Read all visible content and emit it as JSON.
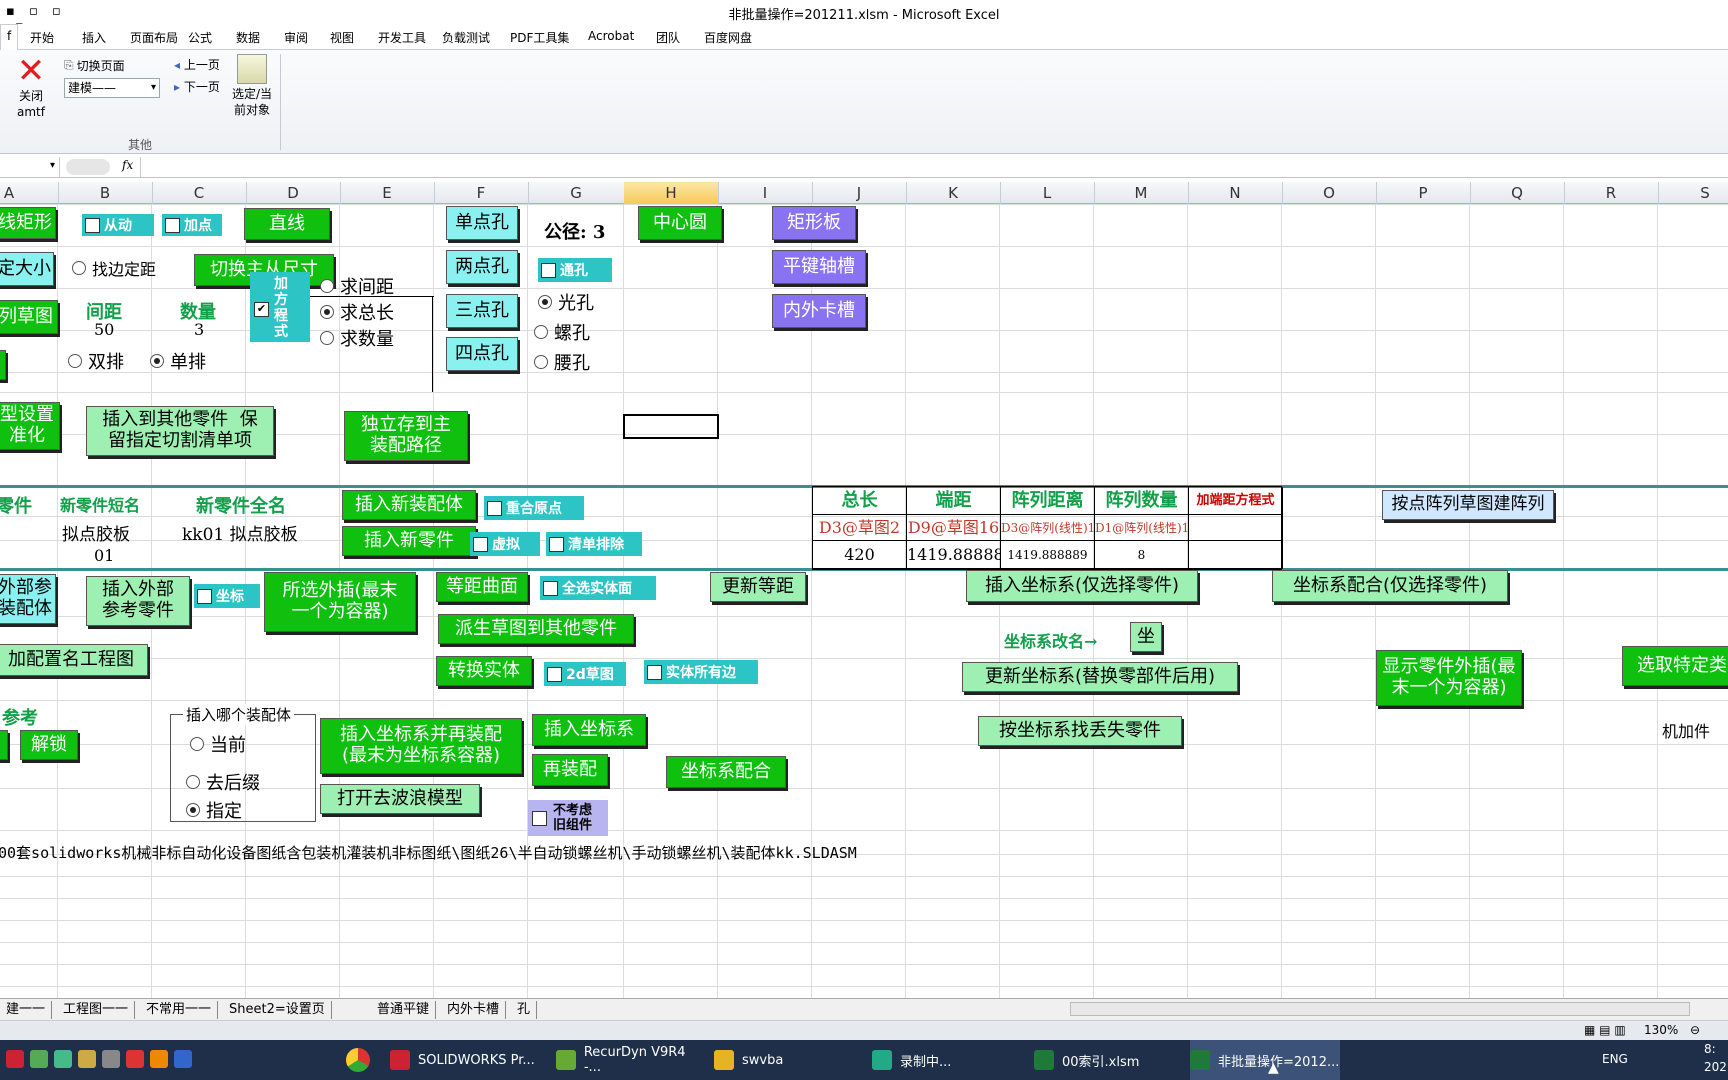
{
  "window": {
    "title": "非批量操作=201211.xlsm  -  Microsoft Excel"
  },
  "ribbon_tabs": [
    "f",
    "开始",
    "插入",
    "页面布局",
    "公式",
    "数据",
    "审阅",
    "视图",
    "开发工具",
    "负载测试",
    "PDF工具集",
    "Acrobat",
    "团队",
    "百度网盘"
  ],
  "ribbon": {
    "close_label": "关闭\namtf",
    "switch_page": "切换页面",
    "combo_value": "建模——",
    "prev_page": "上一页",
    "next_page": "下一页",
    "select_label": "选定/当\n前对象",
    "group_label": "其他"
  },
  "formula_bar": {
    "fx": "fx",
    "value": ""
  },
  "columns": [
    "A",
    "B",
    "C",
    "D",
    "E",
    "F",
    "G",
    "H",
    "I",
    "J",
    "K",
    "L",
    "M",
    "N",
    "O",
    "P",
    "Q",
    "R",
    "S"
  ],
  "selected_column": "H",
  "buttons": {
    "line_rect": "线矩形",
    "fixed_size": "定大小",
    "array_sketch": "列草图",
    "type_setting": "型设置\n准化",
    "line": "直线",
    "switch_main": "切换主从尺寸",
    "insert_other": "插入到其他零件  保\n留指定切割清单项",
    "standalone_save": "独立存到主\n装配路径",
    "single_hole": "单点孔",
    "two_hole": "两点孔",
    "three_hole": "三点孔",
    "four_hole": "四点孔",
    "center_circle": "中心圆",
    "rect_plate": "矩形板",
    "key_slot": "平键轴槽",
    "snap_groove": "内外卡槽",
    "insert_new_asm": "插入新装配体",
    "insert_new_part": "插入新零件",
    "array_by_point": "按点阵列草图建阵列",
    "ext_ref_asm": "外部参\n装配体",
    "insert_ext_ref_part": "插入外部\n参考零件",
    "selected_ext": "所选外插(最末\n一个为容器)",
    "offset_surface": "等距曲面",
    "update_offset": "更新等距",
    "derived_sketch": "派生草图到其他零件",
    "convert_entity": "转换实体",
    "insert_cs_only": "插入坐标系(仅选择零件)",
    "cs_mate_only": "坐标系配合(仅选择零件)",
    "rename_cs_btn": "坐",
    "update_cs": "更新坐标系(替换零部件后用)",
    "find_missing": "按坐标系找丢失零件",
    "show_ext": "显示零件外插(最\n末一个为容器)",
    "select_specific": "选取特定类",
    "add_config_drawing": "加配置名工程图",
    "unlock": "解锁",
    "insert_cs_reasm": "插入坐标系并再装配\n(最末为坐标系容器)",
    "insert_cs": "插入坐标系",
    "reassemble": "再装配",
    "cs_mate": "坐标系配合",
    "open_dewave": "打开去波浪模型"
  },
  "checkboxes": {
    "slave": {
      "label": "从动",
      "checked": true
    },
    "add_point": {
      "label": "加点",
      "checked": false
    },
    "through_hole": {
      "label": "通孔",
      "checked": true
    },
    "equation": {
      "label": "加\n方\n程\n式",
      "checked": true
    },
    "coincide_origin": {
      "label": "重合原点",
      "checked": true
    },
    "virtual": {
      "label": "虚拟",
      "checked": false
    },
    "exclude_bom": {
      "label": "清单排除",
      "checked": false
    },
    "coord": {
      "label": "坐标",
      "checked": false
    },
    "select_all_bodies": {
      "label": "全选实体面",
      "checked": false
    },
    "sketch_2d": {
      "label": "2d草图",
      "checked": false
    },
    "all_edges": {
      "label": "实体所有边",
      "checked": false
    },
    "ignore_old": {
      "label": "不考虑\n旧组件",
      "checked": false
    }
  },
  "radios": {
    "find_edge": {
      "label": "找边定距",
      "checked": false
    },
    "double_row": {
      "label": "双排",
      "checked": false
    },
    "single_row": {
      "label": "单排",
      "checked": true
    },
    "find_spacing": {
      "label": "求间距",
      "checked": false
    },
    "find_total": {
      "label": "求总长",
      "checked": true
    },
    "find_count": {
      "label": "求数量",
      "checked": false
    },
    "smooth_hole": {
      "label": "光孔",
      "checked": true
    },
    "screw_hole": {
      "label": "螺孔",
      "checked": false
    },
    "waist_hole": {
      "label": "腰孔",
      "checked": false
    },
    "asm_current": {
      "label": "当前",
      "checked": false
    },
    "asm_back": {
      "label": "去后缀",
      "checked": false
    },
    "asm_specified": {
      "label": "指定",
      "checked": true
    }
  },
  "cells": {
    "spacing_label": "间距",
    "count_label": "数量",
    "spacing_value": "50",
    "count_value": "3",
    "tolerance": "公径: 3",
    "part_col": "零件",
    "short_name_label": "新零件短名",
    "full_name_label": "新零件全名",
    "short_name_value": "拟点胶板",
    "full_name_value": "kk01 拟点胶板",
    "serial": "01",
    "rename_cs": "坐标系改名→",
    "ref": "参考",
    "insert_which_asm": "插入哪个装配体",
    "machined_part": "机加件",
    "path": "00套solidworks机械非标自动化设备图纸含包装机灌装机非标图纸\\图纸26\\半自动锁螺丝机\\手动锁螺丝机\\装配体kk.SLDASM"
  },
  "param_table": {
    "headers": [
      "总长",
      "端距",
      "阵列距离",
      "阵列数量",
      "加端距方程式"
    ],
    "refs": [
      "D3@草图2",
      "D9@草图16",
      "D3@阵列(线性)1",
      "D1@阵列(线性)1",
      ""
    ],
    "values": [
      "420",
      "1419.888889",
      "1419.888889",
      "8",
      ""
    ]
  },
  "sheet_tabs": [
    "建一一",
    "工程图一一",
    "不常用一一",
    "Sheet2=设置页",
    "普通平键",
    "内外卡槽",
    "孔"
  ],
  "status": {
    "zoom": "130%"
  },
  "taskbar": {
    "items": [
      "SOLIDWORKS Pr...",
      "RecurDyn V9R4  -...",
      "swvba",
      "录制中...",
      "00索引.xlsm",
      "非批量操作=2012..."
    ],
    "lang": "ENG",
    "time": "8:",
    "date": "202"
  },
  "colors": {
    "green_btn": "#0fc00f",
    "cyan_btn": "#8af1f1",
    "purple_btn": "#8a73f2",
    "light_green_btn": "#9df0b2",
    "label_green": "#12a04a"
  }
}
